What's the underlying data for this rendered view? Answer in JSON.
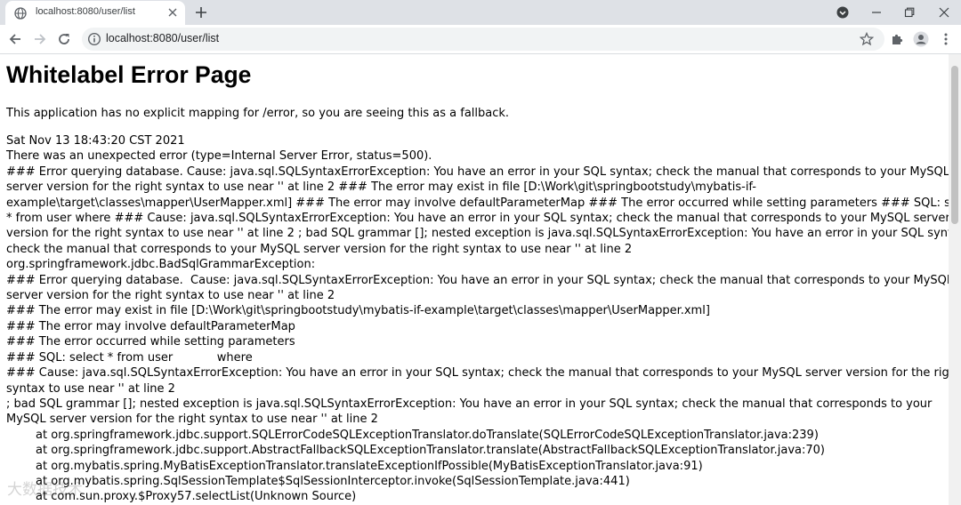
{
  "browser": {
    "tab_title": "localhost:8080/user/list",
    "url": "localhost:8080/user/list",
    "icons": {
      "favicon": "globe-icon",
      "tab_close": "close-icon",
      "new_tab": "plus-icon",
      "media": "media-control-icon",
      "minimize": "minimize-icon",
      "maximize": "restore-icon",
      "close_window": "close-icon",
      "back": "back-arrow-icon",
      "forward": "forward-arrow-icon",
      "reload": "reload-icon",
      "site_info": "info-icon",
      "bookmark": "star-icon",
      "extensions": "puzzle-icon",
      "profile": "profile-icon",
      "menu": "kebab-menu-icon"
    }
  },
  "page": {
    "heading": "Whitelabel Error Page",
    "fallback_text": "This application has no explicit mapping for /error, so you are seeing this as a fallback.",
    "timestamp": "Sat Nov 13 18:43:20 CST 2021",
    "summary": "There was an unexpected error (type=Internal Server Error, status=500).",
    "lines": [
      "### Error querying database. Cause: java.sql.SQLSyntaxErrorException: You have an error in your SQL syntax; check the manual that corresponds to your MySQL",
      "server version for the right syntax to use near '' at line 2 ### The error may exist in file [D:\\Work\\git\\springbootstudy\\mybatis-if-",
      "example\\target\\classes\\mapper\\UserMapper.xml] ### The error may involve defaultParameterMap ### The error occurred while setting parameters ### SQL: select",
      "* from user where ### Cause: java.sql.SQLSyntaxErrorException: You have an error in your SQL syntax; check the manual that corresponds to your MySQL server",
      "version for the right syntax to use near '' at line 2 ; bad SQL grammar []; nested exception is java.sql.SQLSyntaxErrorException: You have an error in your SQL syntax;",
      "check the manual that corresponds to your MySQL server version for the right syntax to use near '' at line 2",
      "org.springframework.jdbc.BadSqlGrammarException:",
      "### Error querying database.  Cause: java.sql.SQLSyntaxErrorException: You have an error in your SQL syntax; check the manual that corresponds to your MySQL",
      "server version for the right syntax to use near '' at line 2",
      "### The error may exist in file [D:\\Work\\git\\springbootstudy\\mybatis-if-example\\target\\classes\\mapper\\UserMapper.xml]",
      "### The error may involve defaultParameterMap",
      "### The error occurred while setting parameters",
      "### SQL: select * from user            where",
      "### Cause: java.sql.SQLSyntaxErrorException: You have an error in your SQL syntax; check the manual that corresponds to your MySQL server version for the right",
      "syntax to use near '' at line 2",
      "; bad SQL grammar []; nested exception is java.sql.SQLSyntaxErrorException: You have an error in your SQL syntax; check the manual that corresponds to your",
      "MySQL server version for the right syntax to use near '' at line 2",
      "        at org.springframework.jdbc.support.SQLErrorCodeSQLExceptionTranslator.doTranslate(SQLErrorCodeSQLExceptionTranslator.java:239)",
      "        at org.springframework.jdbc.support.AbstractFallbackSQLExceptionTranslator.translate(AbstractFallbackSQLExceptionTranslator.java:70)",
      "        at org.mybatis.spring.MyBatisExceptionTranslator.translateExceptionIfPossible(MyBatisExceptionTranslator.java:91)",
      "        at org.mybatis.spring.SqlSessionTemplate$SqlSessionInterceptor.invoke(SqlSessionTemplate.java:441)",
      "        at com.sun.proxy.$Proxy57.selectList(Unknown Source)"
    ]
  },
  "watermark": "大数据技术"
}
